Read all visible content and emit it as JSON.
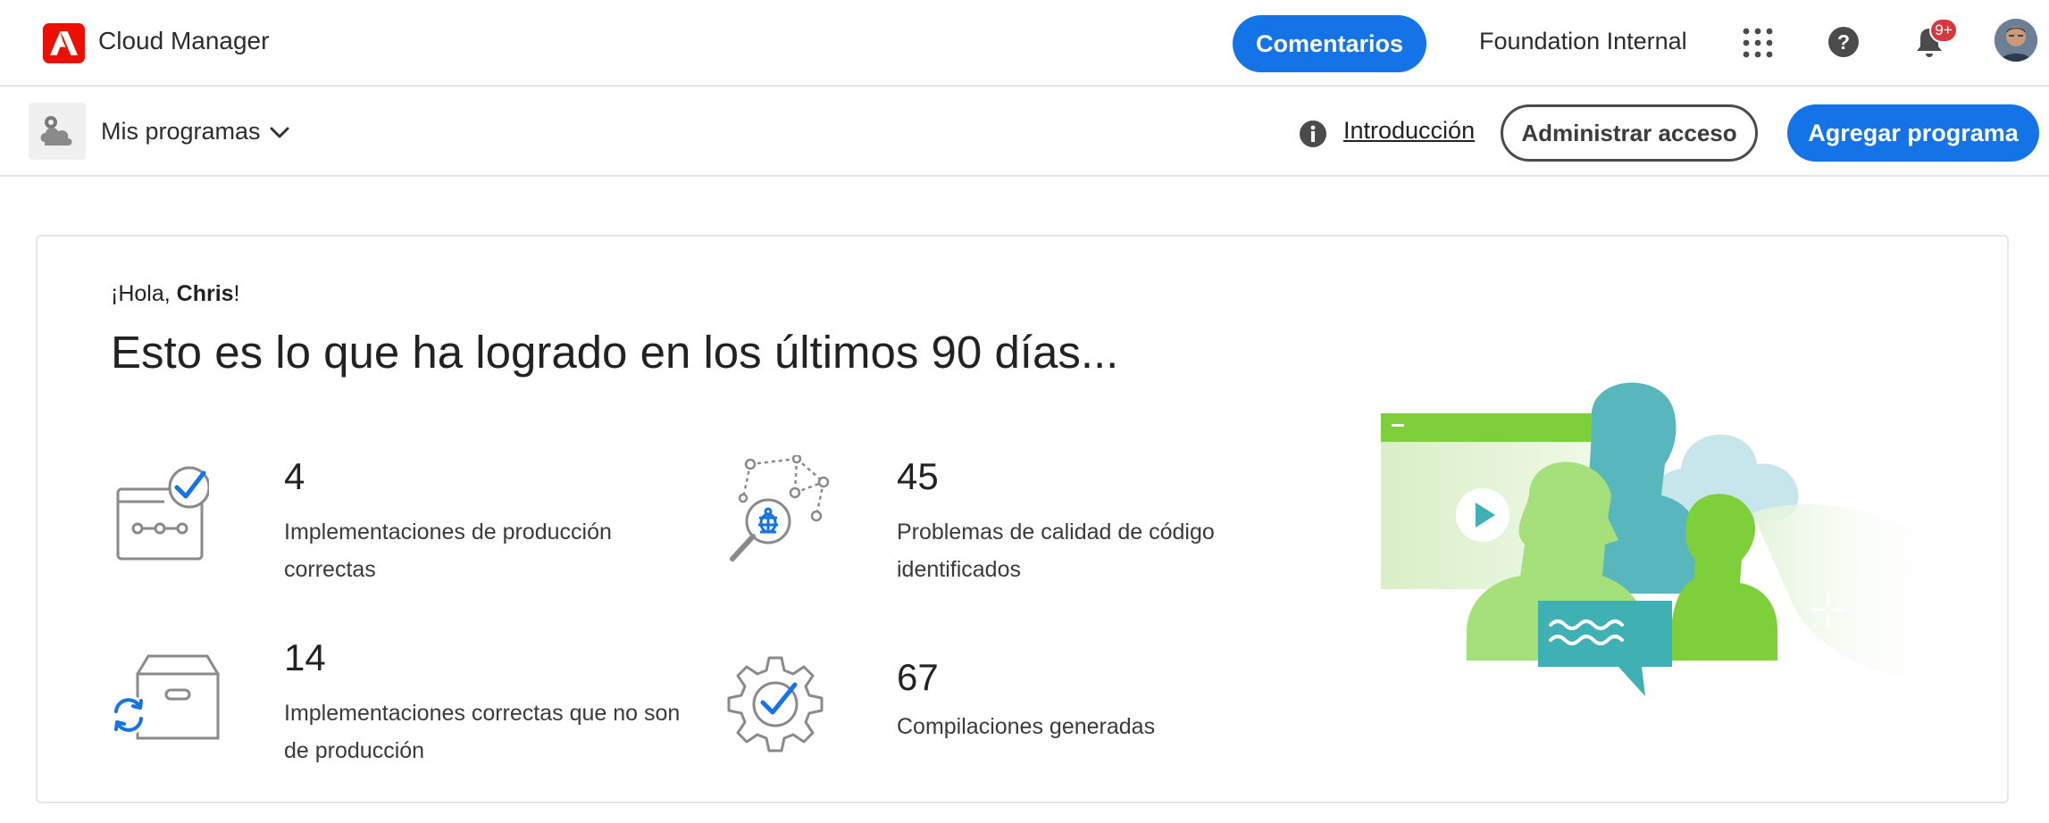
{
  "header": {
    "app_title": "Cloud Manager",
    "feedback_label": "Comentarios",
    "org_name": "Foundation Internal",
    "notifications_badge": "9+",
    "icons": [
      "adobe-logo",
      "apps-grid-icon",
      "help-icon",
      "bell-icon",
      "avatar"
    ]
  },
  "subbar": {
    "programs_label": "Mis programas",
    "intro_link": "Introducción",
    "manage_access_label": "Administrar acceso",
    "add_program_label": "Agregar programa"
  },
  "main": {
    "greeting_prefix": "¡Hola, ",
    "greeting_name": "Chris",
    "greeting_suffix": "!",
    "headline": "Esto es lo que ha logrado en los últimos 90 días...",
    "stats": [
      {
        "value": "4",
        "label": "Implementaciones de producción correctas",
        "icon": "pipeline-check-icon"
      },
      {
        "value": "45",
        "label": "Problemas de calidad de código identificados",
        "icon": "bug-search-icon"
      },
      {
        "value": "14",
        "label": "Implementaciones correctas que no son de producción",
        "icon": "box-refresh-icon"
      },
      {
        "value": "67",
        "label": "Compilaciones generadas",
        "icon": "gear-check-icon"
      }
    ]
  },
  "colors": {
    "accent": "#1473e6",
    "adobe_red": "#eb1000",
    "badge_red": "#d7373f",
    "illustration_green": "#7ed03b",
    "illustration_teal": "#3fb1b5"
  }
}
